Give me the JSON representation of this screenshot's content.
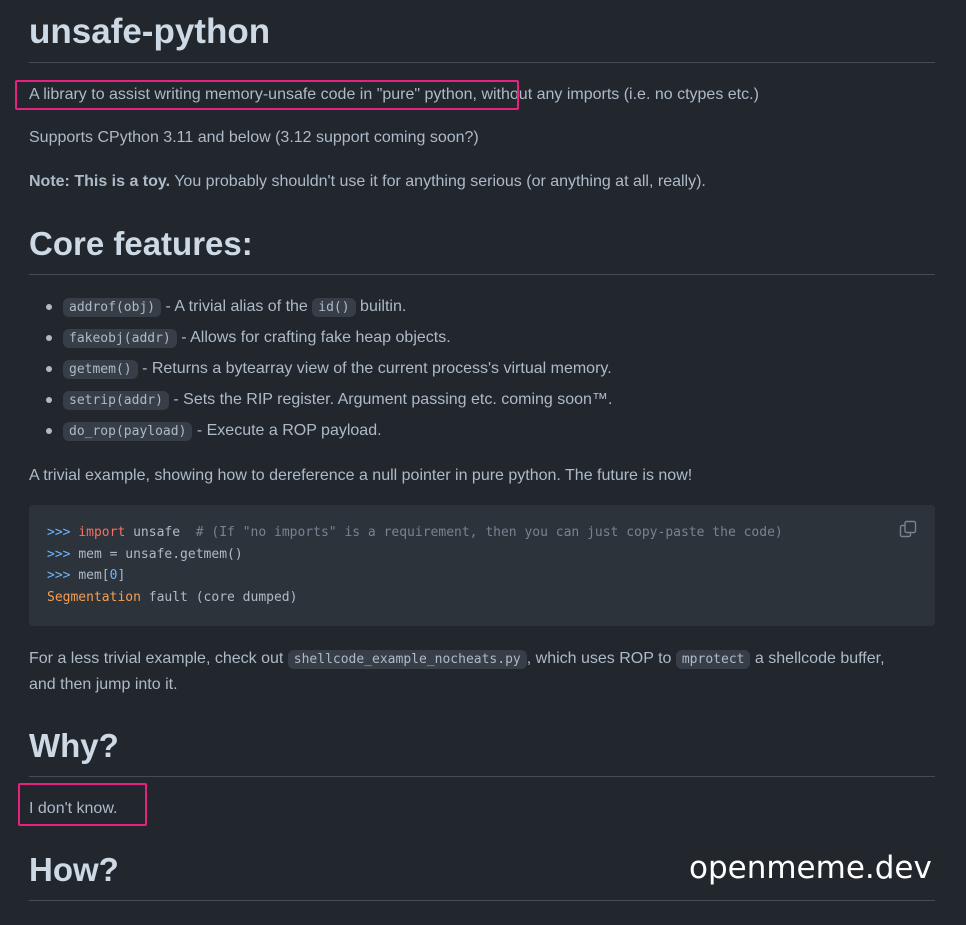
{
  "title": "unsafe-python",
  "intro": {
    "highlighted": "A library to assist writing memory-unsafe code in \"pure\" python,",
    "rest": " without any imports (i.e. no ctypes etc.)"
  },
  "support_line": "Supports CPython 3.11 and below (3.12 support coming soon?)",
  "note": {
    "label": "Note:",
    "bold": " This is a toy.",
    "rest": " You probably shouldn't use it for anything serious (or anything at all, really)."
  },
  "core_heading": "Core features:",
  "features": [
    {
      "code": "addrof(obj)",
      "text1": " - A trivial alias of the ",
      "code2": "id()",
      "text2": " builtin."
    },
    {
      "code": "fakeobj(addr)",
      "text1": " - Allows for crafting fake heap objects.",
      "code2": "",
      "text2": ""
    },
    {
      "code": "getmem()",
      "text1": " - Returns a bytearray view of the current process's virtual memory.",
      "code2": "",
      "text2": ""
    },
    {
      "code": "setrip(addr)",
      "text1": " - Sets the RIP register. Argument passing etc. coming soon™.",
      "code2": "",
      "text2": ""
    },
    {
      "code": "do_rop(payload)",
      "text1": " - Execute a ROP payload.",
      "code2": "",
      "text2": ""
    }
  ],
  "example_intro": "A trivial example, showing how to dereference a null pointer in pure python. The future is now!",
  "code": {
    "line1_prompt": ">>> ",
    "line1_kw": "import",
    "line1_mod": " unsafe  ",
    "line1_comment": "# (If \"no imports\" is a requirement, then you can just copy-paste the code)",
    "line2_prompt": ">>> ",
    "line2_code": "mem = unsafe.getmem()",
    "line3_prompt": ">>> ",
    "line3_pre": "mem[",
    "line3_num": "0",
    "line3_post": "]",
    "line4_err": "Segmentation",
    "line4_rest": " fault (core dumped)"
  },
  "less_trivial": {
    "pre": "For a less trivial example, check out ",
    "file": "shellcode_example_nocheats.py",
    "mid": ", which uses ROP to ",
    "func": "mprotect",
    "post": " a shellcode buffer,",
    "line2": "and then jump into it."
  },
  "why_heading": "Why?",
  "why_answer": "I don't know.",
  "how_heading": "How?",
  "watermark": "openmeme.dev",
  "colors": {
    "background": "#22272e",
    "highlight_box": "#e7217f",
    "text": "#adbac7"
  }
}
